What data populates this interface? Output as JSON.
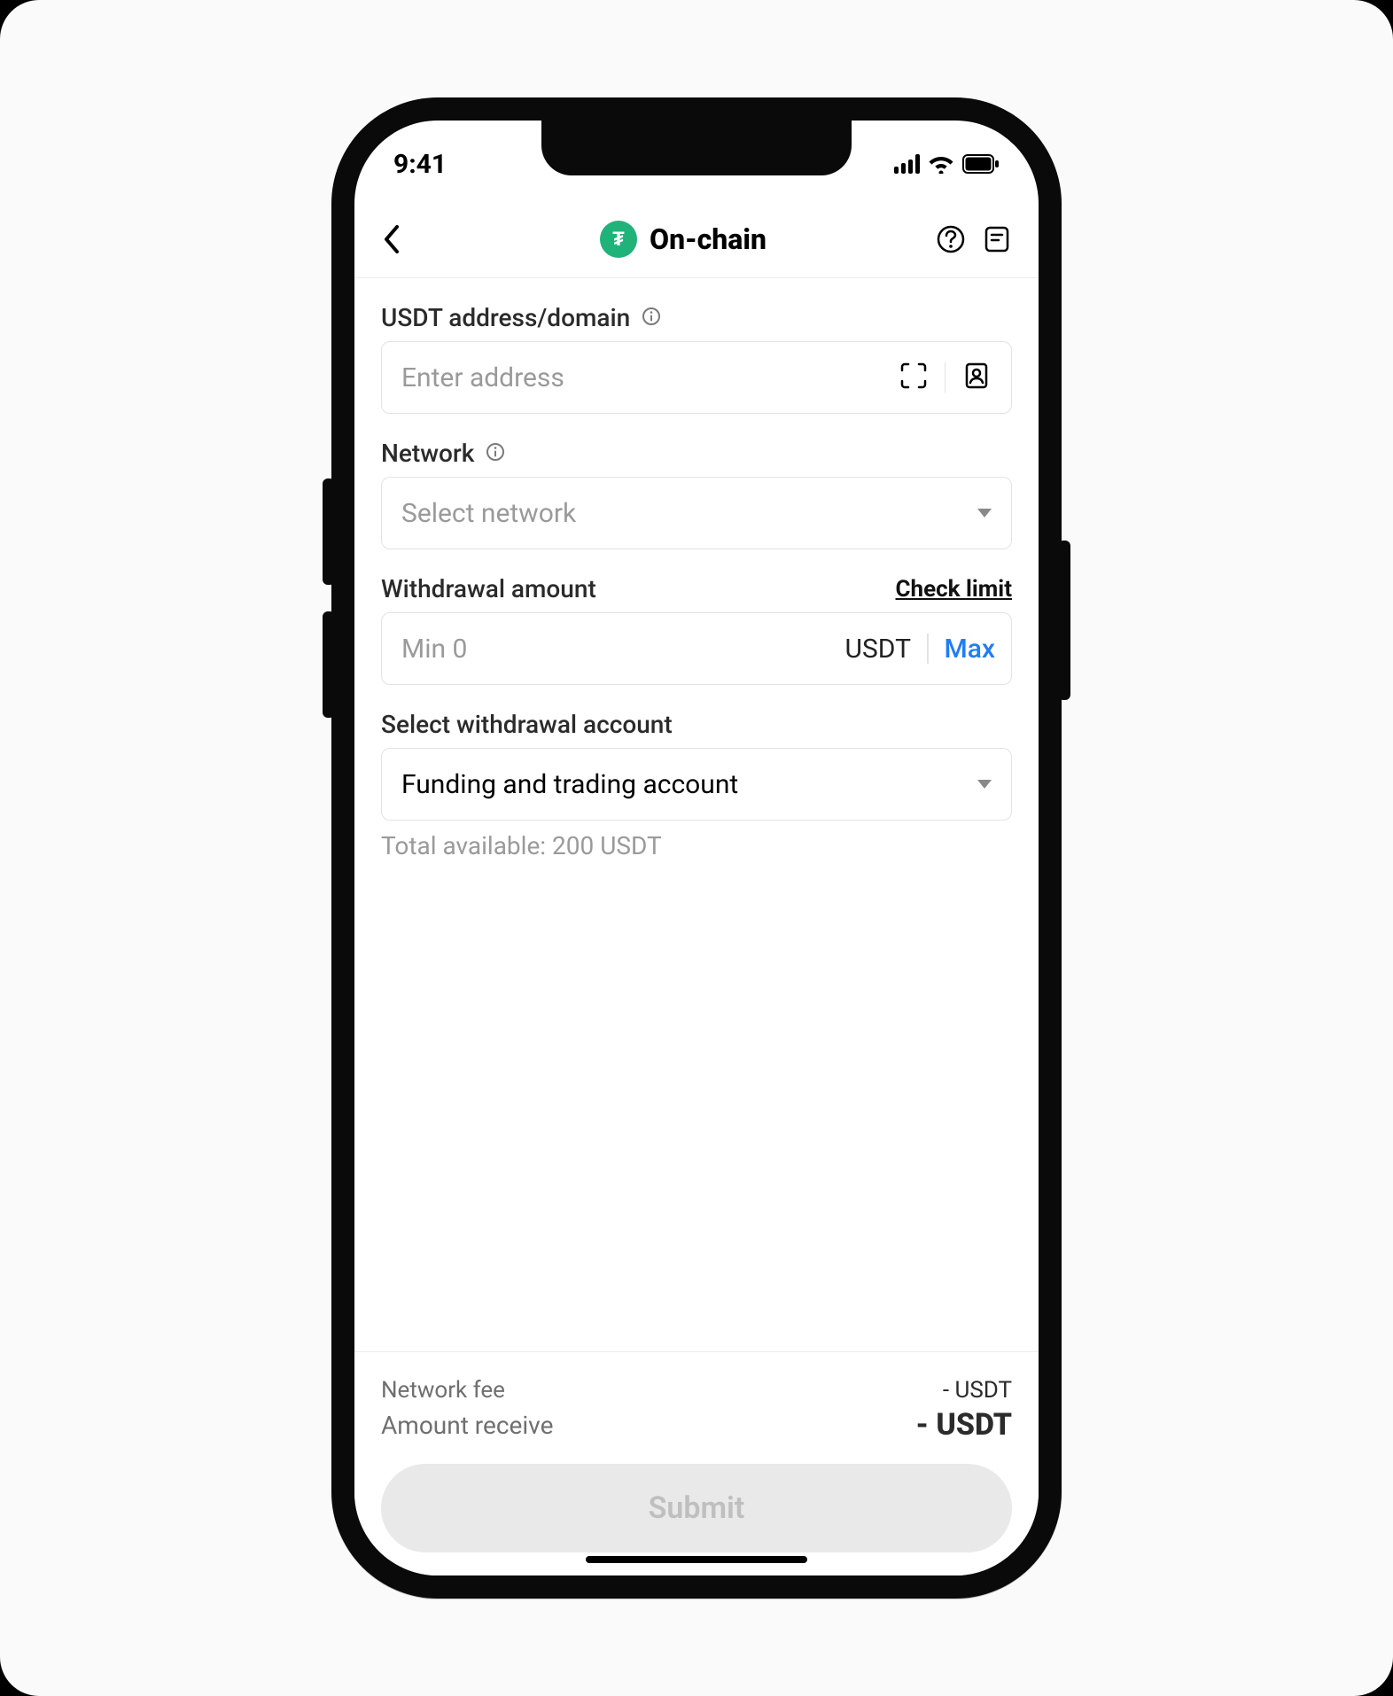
{
  "status": {
    "time": "9:41"
  },
  "header": {
    "title": "On-chain",
    "token_symbol": "₮"
  },
  "address": {
    "label": "USDT address/domain",
    "placeholder": "Enter address"
  },
  "network": {
    "label": "Network",
    "placeholder": "Select network"
  },
  "amount": {
    "label": "Withdrawal amount",
    "check_limit": "Check limit",
    "placeholder": "Min 0",
    "currency": "USDT",
    "max_label": "Max"
  },
  "account": {
    "label": "Select withdrawal account",
    "selected": "Funding and trading account",
    "total_available": "Total available: 200 USDT"
  },
  "summary": {
    "network_fee_label": "Network fee",
    "network_fee_value": "- USDT",
    "amount_receive_label": "Amount receive",
    "amount_receive_value": "- USDT",
    "submit_label": "Submit"
  }
}
